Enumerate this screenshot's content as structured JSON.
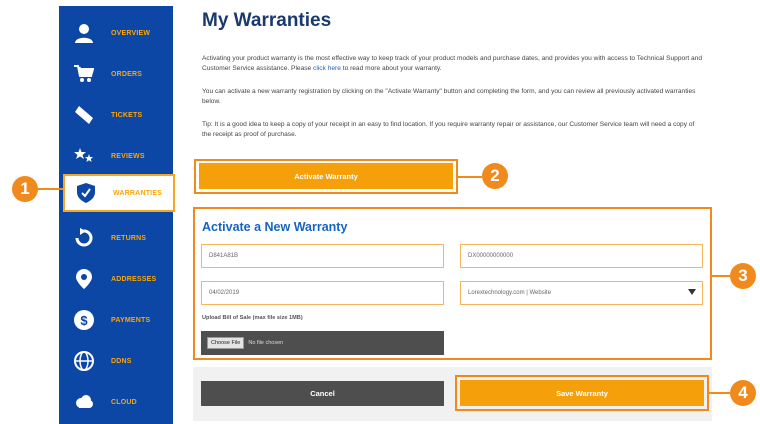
{
  "nav": {
    "items": [
      {
        "label": "OVERVIEW",
        "icon": "user-icon"
      },
      {
        "label": "ORDERS",
        "icon": "cart-icon"
      },
      {
        "label": "TICKETS",
        "icon": "ticket-icon"
      },
      {
        "label": "REVIEWS",
        "icon": "stars-icon"
      },
      {
        "label": "WARRANTIES",
        "icon": "shield-icon"
      },
      {
        "label": "RETURNS",
        "icon": "return-icon"
      },
      {
        "label": "ADDRESSES",
        "icon": "map-pin-icon"
      },
      {
        "label": "PAYMENTS",
        "icon": "dollar-icon"
      },
      {
        "label": "DDNS",
        "icon": "globe-icon"
      },
      {
        "label": "CLOUD",
        "icon": "cloud-icon"
      }
    ]
  },
  "callouts": [
    "1",
    "2",
    "3",
    "4"
  ],
  "page": {
    "title": "My Warranties",
    "intro_1": "Activating your product warranty is the most effective way to keep track of your product models and purchase dates, and provides you with access to Technical Support and Customer Service assistance. Please ",
    "intro_link": "click here",
    "intro_2": " to read more about your warranty.",
    "para2": "You can activate a new warranty registration by clicking on the \"Activate Warranty\" button and completing the form, and you can review all previously activated warranties below.",
    "para3": "Tip: It is a good idea to keep a copy of your receipt in an easy to find location. If you require warranty repair or assistance, our Customer Service team will need a copy of the receipt as proof of purchase.",
    "activate_button": "Activate Warranty"
  },
  "form": {
    "title": "Activate a New Warranty",
    "model": "D841A81B",
    "serial": "DX00000000000",
    "date": "04/02/2019",
    "purchase_source": "Lorextechnology.com | Website",
    "upload_label": "Upload Bill of Sale (max file size 1MB)",
    "choose_file": "Choose File",
    "no_file": "No file chosen",
    "cancel": "Cancel",
    "save": "Save Warranty"
  },
  "colors": {
    "sidebar": "#0d47a6",
    "accent": "#f5a00a",
    "callout": "#f08a1c",
    "title": "#1a3a6e",
    "dark_button": "#4e4e4e"
  }
}
